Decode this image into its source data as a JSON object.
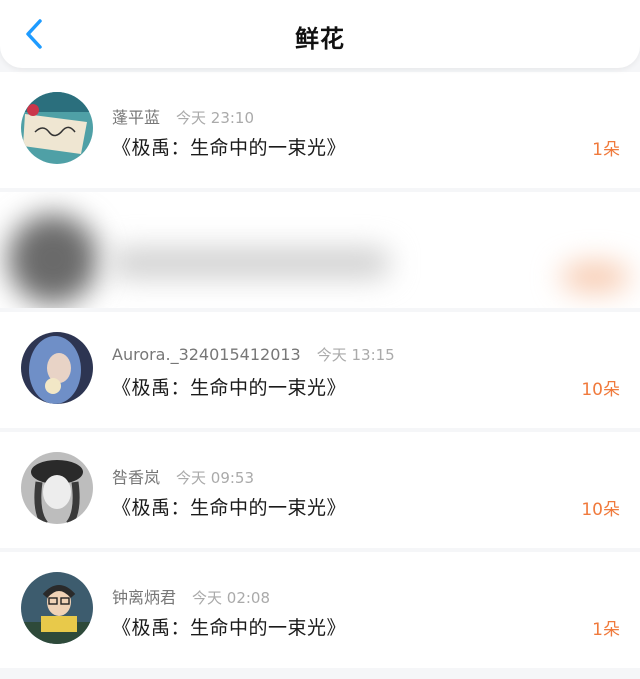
{
  "header": {
    "title": "鲜花",
    "back_icon": "chevron-left-icon",
    "accent": "#1e9bff"
  },
  "items": [
    {
      "name": "蓬平蓝",
      "time": "今天 23:10",
      "book": "《极禹：生命中的一束光》",
      "count": "1朵",
      "avatar": "avatar-love-note"
    },
    {
      "name": "",
      "time": "",
      "book": "",
      "count": "",
      "avatar": "blurred"
    },
    {
      "name": "Aurora._324015412013",
      "time": "今天 13:15",
      "book": "《极禹：生命中的一束光》",
      "count": "10朵",
      "avatar": "avatar-blue-hair"
    },
    {
      "name": "咎香岚",
      "time": "今天 09:53",
      "book": "《极禹：生命中的一束光》",
      "count": "10朵",
      "avatar": "avatar-bw-hat"
    },
    {
      "name": "钟离炳君",
      "time": "今天 02:08",
      "book": "《极禹：生命中的一束光》",
      "count": "1朵",
      "avatar": "avatar-glasses"
    }
  ],
  "colors": {
    "count": "#f07a3c",
    "name": "#777777",
    "time": "#aaaaaa"
  }
}
